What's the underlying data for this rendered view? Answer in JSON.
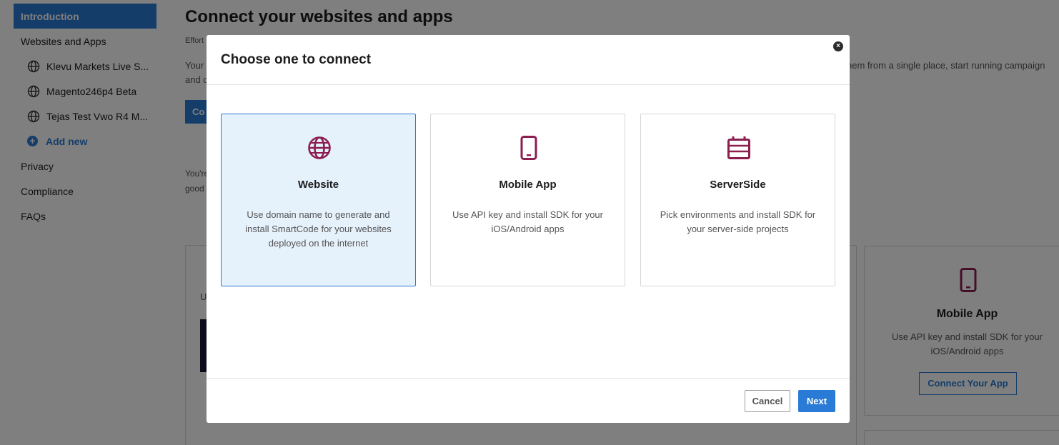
{
  "sidebar": {
    "intro_label": "Introduction",
    "websites_label": "Websites and Apps",
    "items": [
      {
        "label": "Klevu Markets Live S..."
      },
      {
        "label": "Magento246p4 Beta"
      },
      {
        "label": "Tejas Test Vwo R4 M..."
      }
    ],
    "add_new_label": "Add new",
    "privacy_label": "Privacy",
    "compliance_label": "Compliance",
    "faqs_label": "FAQs"
  },
  "main": {
    "title": "Connect your websites and apps",
    "effort_text": "Effort",
    "desc_line1_left": "Your",
    "desc_line1_right": "hem from a single place, start running campaign",
    "desc_line2_left": "and c",
    "connect_button_fragment": "Co",
    "note_line1": "You're",
    "note_line2": "good",
    "card_fragment_text": "U",
    "app_card": {
      "title": "Mobile App",
      "description": "Use API key and install SDK for your iOS/Android apps",
      "button_label": "Connect Your App"
    }
  },
  "modal": {
    "title": "Choose one to connect",
    "close_label": "×",
    "options": [
      {
        "title": "Website",
        "description": "Use domain name to generate and install SmartCode for your websites deployed on the internet",
        "icon": "globe-icon",
        "selected": true
      },
      {
        "title": "Mobile App",
        "description": "Use API key and install SDK for your iOS/Android apps",
        "icon": "mobile-phone-icon",
        "selected": false
      },
      {
        "title": "ServerSide",
        "description": "Pick environments and install SDK for your server-side projects",
        "icon": "server-icon",
        "selected": false
      }
    ],
    "cancel_label": "Cancel",
    "next_label": "Next"
  },
  "colors": {
    "accent": "#2a7bd5",
    "icon": "#8b1e4f",
    "selected_bg": "#e5f1fb"
  }
}
